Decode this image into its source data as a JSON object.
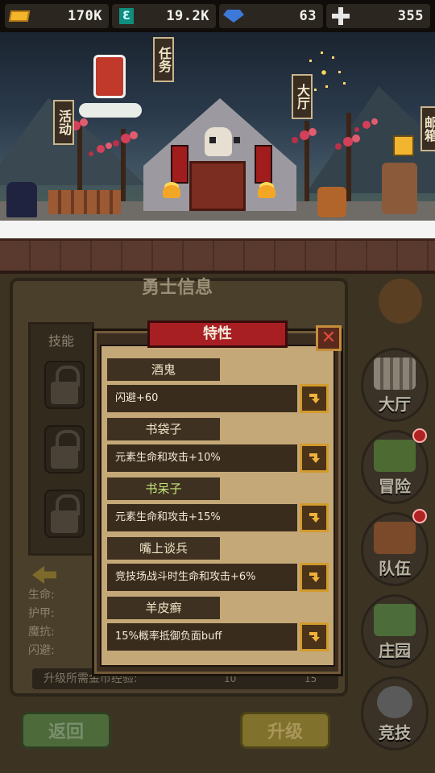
{
  "currencies": [
    {
      "icon": "gold-coin-icon",
      "value": "170K"
    },
    {
      "icon": "element-icon",
      "value": "19.2K"
    },
    {
      "icon": "blue-gem-icon",
      "value": "63"
    },
    {
      "icon": "cross-token-icon",
      "value": "355"
    }
  ],
  "scene": {
    "signs": {
      "quest": "任务",
      "activity": "活动",
      "hall": "大厅",
      "mailbox": "邮箱"
    }
  },
  "hero_panel": {
    "title": "勇士信息",
    "skills_label": "技能",
    "stats": [
      "生命:",
      "护甲:",
      "魔抗:",
      "闪避:"
    ],
    "upgrade_cost_label": "升级所需金币经验:",
    "upgrade_gold": "10",
    "upgrade_exp": "15",
    "back_label": "返回",
    "levelup_label": "升级"
  },
  "side_nav": [
    {
      "label": "大厅",
      "icon": "hall-icon",
      "alert": false
    },
    {
      "label": "冒险",
      "icon": "adventure-icon",
      "alert": true
    },
    {
      "label": "队伍",
      "icon": "team-icon",
      "alert": true
    },
    {
      "label": "庄园",
      "icon": "manor-icon",
      "alert": false
    },
    {
      "label": "竞技",
      "icon": "arena-icon",
      "alert": false
    }
  ],
  "modal": {
    "title": "特性",
    "traits": [
      {
        "name": "酒鬼",
        "desc": "闪避+60"
      },
      {
        "name": "书袋子",
        "desc": "元素生命和攻击+10%"
      },
      {
        "name": "书呆子",
        "desc": "元素生命和攻击+15%"
      },
      {
        "name": "嘴上谈兵",
        "desc": "竞技场战斗时生命和攻击+6%"
      },
      {
        "name": "羊皮癣",
        "desc": "15%概率抵御负面buff"
      }
    ]
  }
}
